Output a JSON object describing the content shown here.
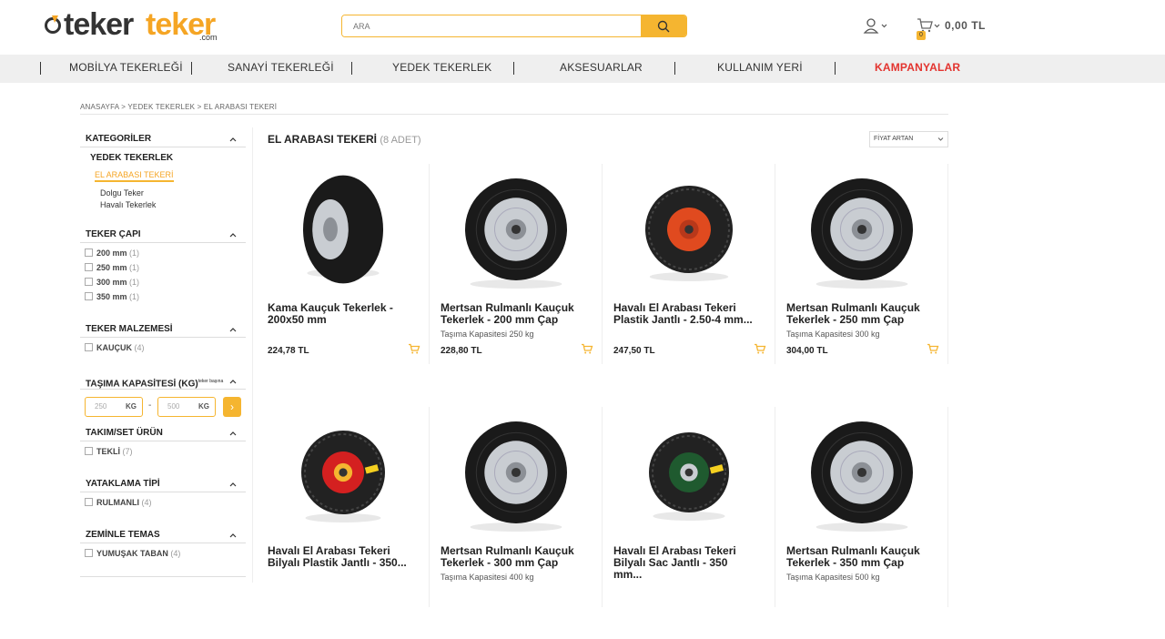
{
  "brand": {
    "part1": "teker",
    "part2": "teker",
    "suffix": ".com"
  },
  "search": {
    "placeholder": "ARA"
  },
  "cart": {
    "count": "0",
    "total": "0,00 TL"
  },
  "nav": [
    {
      "label": "MOBİLYA TEKERLEĞİ"
    },
    {
      "label": "SANAYİ TEKERLEĞİ"
    },
    {
      "label": "YEDEK TEKERLEK"
    },
    {
      "label": "AKSESUARLAR"
    },
    {
      "label": "KULLANIM YERİ"
    },
    {
      "label": "KAMPANYALAR"
    }
  ],
  "breadcrumb": "ANASAYFA > YEDEK TEKERLEK > EL ARABASI TEKERİ",
  "sidebar": {
    "categories": {
      "title": "KATEGORİLER",
      "parent": "YEDEK TEKERLEK",
      "active": "EL ARABASI TEKERİ",
      "children": [
        "Dolgu Teker",
        "Havalı Tekerlek"
      ]
    },
    "diameter": {
      "title": "TEKER ÇAPI",
      "options": [
        {
          "label": "200 mm",
          "count": "(1)"
        },
        {
          "label": "250 mm",
          "count": "(1)"
        },
        {
          "label": "300 mm",
          "count": "(1)"
        },
        {
          "label": "350 mm",
          "count": "(1)"
        }
      ]
    },
    "material": {
      "title": "TEKER MALZEMESİ",
      "options": [
        {
          "label": "KAUÇUK",
          "count": "(4)"
        }
      ]
    },
    "capacity": {
      "title": "TAŞIMA KAPASİTESİ (KG)",
      "note": "teker başına",
      "min": "250",
      "max": "500",
      "unit": "KG",
      "dash": "-",
      "go": "›"
    },
    "set": {
      "title": "TAKIM/SET ÜRÜN",
      "options": [
        {
          "label": "TEKLİ",
          "count": "(7)"
        }
      ]
    },
    "bearing": {
      "title": "YATAKLAMA TİPİ",
      "options": [
        {
          "label": "RULMANLI",
          "count": "(4)"
        }
      ]
    },
    "contact": {
      "title": "ZEMİNLE TEMAS",
      "options": [
        {
          "label": "YUMUŞAK TABAN",
          "count": "(4)"
        }
      ]
    }
  },
  "listing": {
    "title": "EL ARABASI TEKERİ",
    "count": "(8 ADET)",
    "sort": "FİYAT ARTAN"
  },
  "products": [
    {
      "name": "Kama Kauçuk Tekerlek - 200x50 mm",
      "capacity": "",
      "price": "224,78 TL"
    },
    {
      "name": "Mertsan Rulmanlı Kauçuk Tekerlek - 200 mm Çap",
      "capacity": "Taşıma Kapasitesi 250 kg",
      "price": "228,80 TL"
    },
    {
      "name": "Havalı El Arabası Tekeri Plastik Jantlı - 2.50-4 mm...",
      "capacity": "",
      "price": "247,50 TL"
    },
    {
      "name": "Mertsan Rulmanlı Kauçuk Tekerlek - 250 mm Çap",
      "capacity": "Taşıma Kapasitesi 300 kg",
      "price": "304,00 TL"
    },
    {
      "name": "Havalı El Arabası Tekeri Bilyalı Plastik Jantlı - 350...",
      "capacity": "",
      "price": ""
    },
    {
      "name": "Mertsan Rulmanlı Kauçuk Tekerlek - 300 mm Çap",
      "capacity": "Taşıma Kapasitesi 400 kg",
      "price": ""
    },
    {
      "name": "Havalı El Arabası Tekeri Bilyalı Sac Jantlı - 350 mm...",
      "capacity": "",
      "price": ""
    },
    {
      "name": "Mertsan Rulmanlı Kauçuk Tekerlek - 350 mm Çap",
      "capacity": "Taşıma Kapasitesi 500 kg",
      "price": ""
    }
  ],
  "colors": {
    "accent": "#f5b530",
    "campaign": "#e3342f",
    "navbg": "#efefef"
  }
}
